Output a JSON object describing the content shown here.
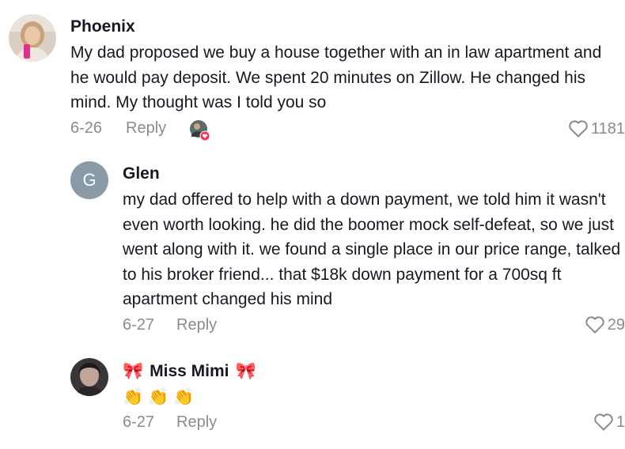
{
  "comments": [
    {
      "author": "Phoenix",
      "text": "My dad proposed we buy a house together with an in law apartment and he would pay deposit. We spent 20 minutes on Zillow. He changed his mind. My thought was I told you so",
      "date": "6-26",
      "reply_label": "Reply",
      "likes": "1181",
      "liked_by_creator": true
    },
    {
      "author": "Glen",
      "avatar_letter": "G",
      "text": "my dad offered to help with a down payment, we told him it wasn't even worth looking. he did the boomer mock self-defeat, so we just went along with it. we found a single place in our price range, talked to his broker friend... that $18k down payment for a 700sq ft apartment changed his mind",
      "date": "6-27",
      "reply_label": "Reply",
      "likes": "29"
    },
    {
      "author": "Miss Mimi",
      "author_prefix": "🎀",
      "author_suffix": "🎀",
      "text": "👏👏👏",
      "date": "6-27",
      "reply_label": "Reply",
      "likes": "1"
    }
  ],
  "colors": {
    "text": "#161823",
    "meta": "#8a8b91",
    "avatar_g": "#8a9aa6",
    "heart_badge": "#fe2c55"
  },
  "icons": {
    "like": "heart-outline-icon",
    "bow": "ribbon-bow-icon",
    "clap": "clapping-hands-icon"
  }
}
